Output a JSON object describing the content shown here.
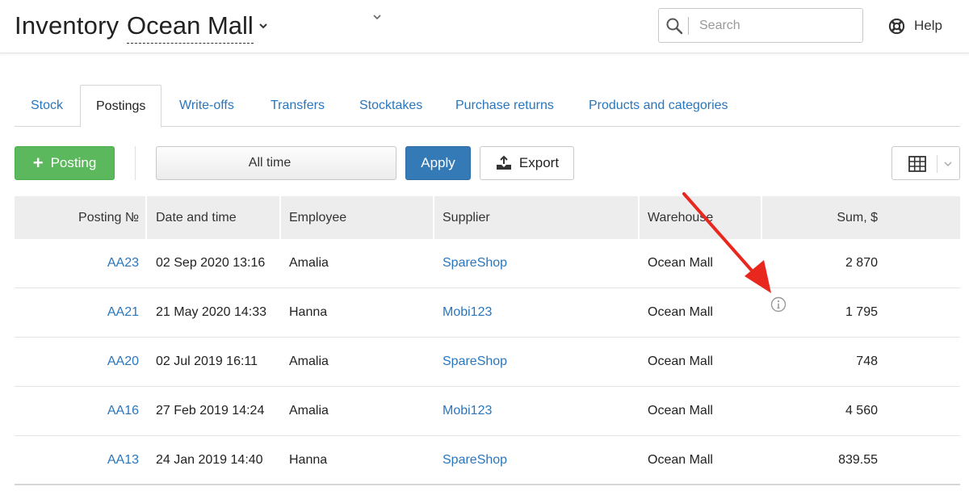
{
  "header": {
    "title": "Inventory",
    "store": "Ocean Mall",
    "search_placeholder": "Search",
    "help_label": "Help"
  },
  "tabs": [
    {
      "label": "Stock",
      "active": false
    },
    {
      "label": "Postings",
      "active": true
    },
    {
      "label": "Write-offs",
      "active": false
    },
    {
      "label": "Transfers",
      "active": false
    },
    {
      "label": "Stocktakes",
      "active": false
    },
    {
      "label": "Purchase returns",
      "active": false
    },
    {
      "label": "Products and categories",
      "active": false
    }
  ],
  "toolbar": {
    "posting_label": "Posting",
    "period_value": "All time",
    "apply_label": "Apply",
    "export_label": "Export"
  },
  "table": {
    "columns": [
      "Posting №",
      "Date and time",
      "Employee",
      "Supplier",
      "Warehouse",
      "Sum, $"
    ],
    "rows": [
      {
        "number": "AA23",
        "datetime": "02 Sep 2020 13:16",
        "employee": "Amalia",
        "supplier": "SpareShop",
        "warehouse": "Ocean Mall",
        "sum": "2 870"
      },
      {
        "number": "AA21",
        "datetime": "21 May 2020 14:33",
        "employee": "Hanna",
        "supplier": "Mobi123",
        "warehouse": "Ocean Mall",
        "sum": "1 795"
      },
      {
        "number": "AA20",
        "datetime": "02 Jul 2019 16:11",
        "employee": "Amalia",
        "supplier": "SpareShop",
        "warehouse": "Ocean Mall",
        "sum": "748"
      },
      {
        "number": "AA16",
        "datetime": "27 Feb 2019 14:24",
        "employee": "Amalia",
        "supplier": "Mobi123",
        "warehouse": "Ocean Mall",
        "sum": "4 560"
      },
      {
        "number": "AA13",
        "datetime": "24 Jan 2019 14:40",
        "employee": "Hanna",
        "supplier": "SpareShop",
        "warehouse": "Ocean Mall",
        "sum": "839.55"
      }
    ]
  },
  "icons": {
    "search": "search-icon",
    "help": "lifebuoy-icon",
    "export": "export-icon",
    "columns": "table-grid-icon",
    "info": "info-icon",
    "annotation": "red-arrow"
  },
  "colors": {
    "link": "#2a76bd",
    "posting_button": "#5cb85c",
    "apply_button": "#337ab7",
    "header_row": "#ededed",
    "annotation_arrow": "#e8281e"
  }
}
